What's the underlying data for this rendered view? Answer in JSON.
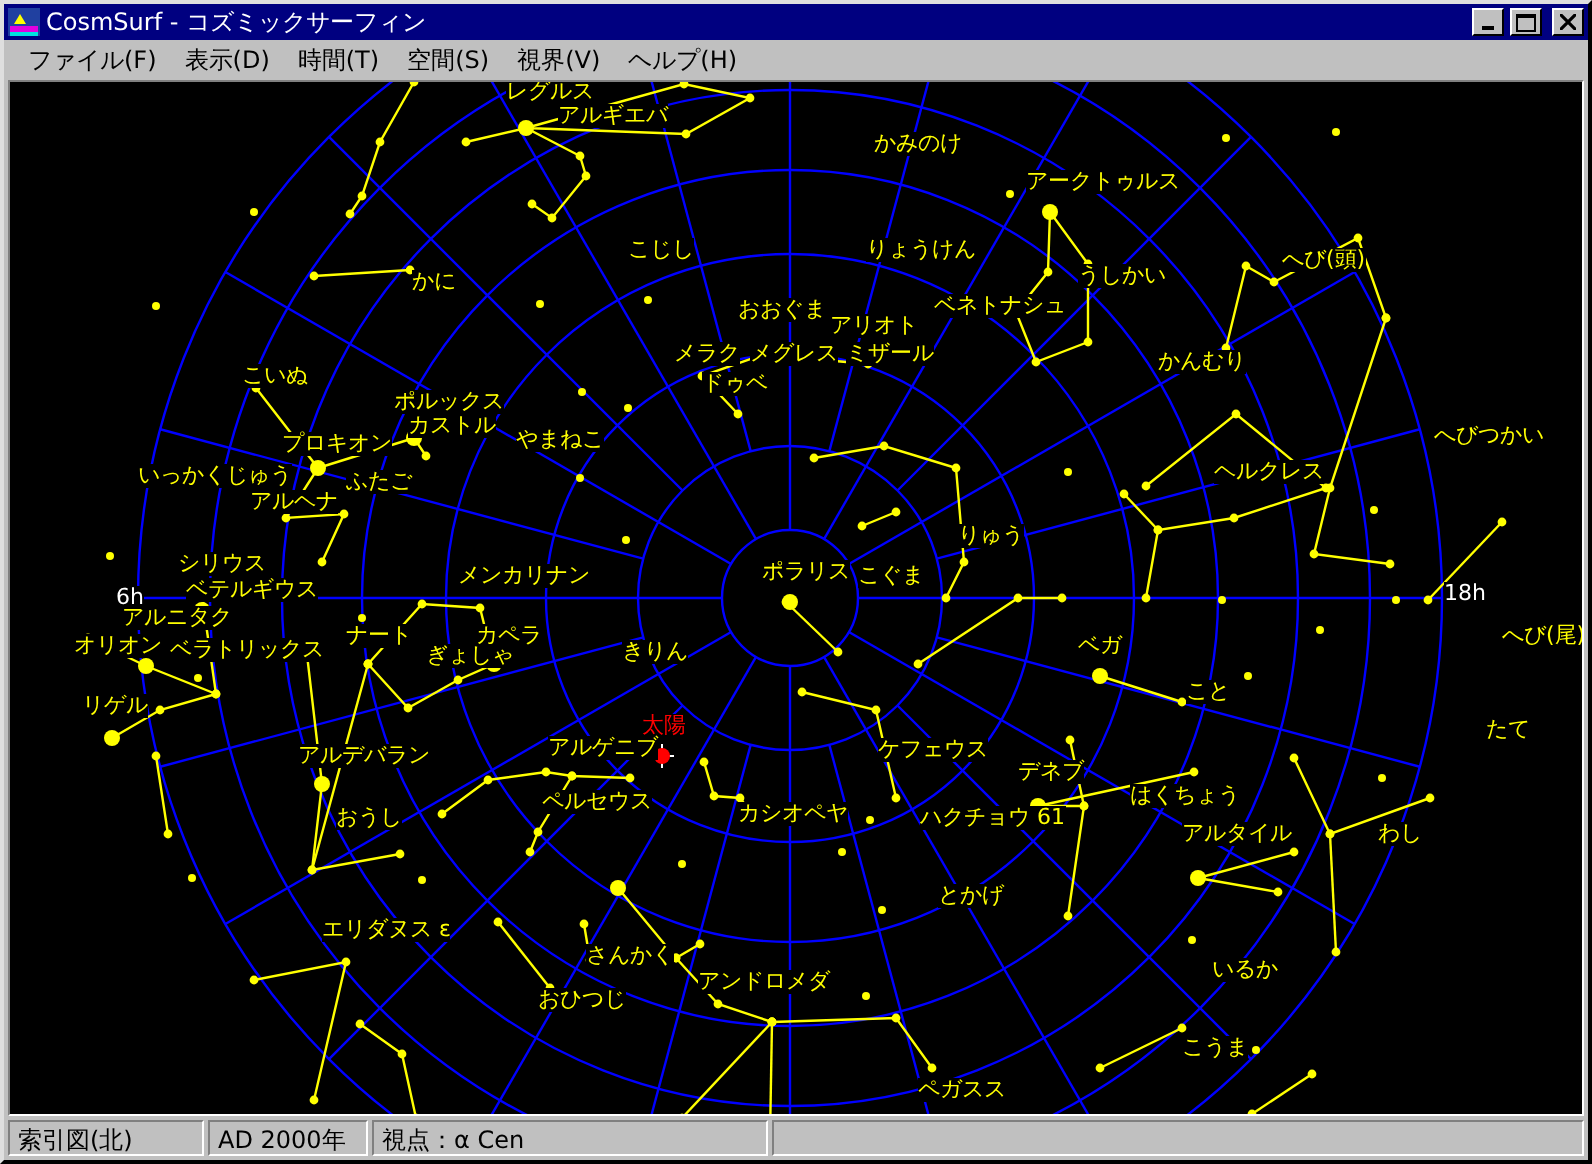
{
  "window": {
    "title": "CosmSurf - コズミックサーフィン"
  },
  "menu": [
    {
      "label": "ファイル(F)"
    },
    {
      "label": "表示(D)"
    },
    {
      "label": "時間(T)"
    },
    {
      "label": "空間(S)"
    },
    {
      "label": "視界(V)"
    },
    {
      "label": "ヘルプ(H)"
    }
  ],
  "sky_chart": {
    "labels": [
      {
        "text": "レグルス",
        "kind": "star"
      },
      {
        "text": "アルギエバ",
        "kind": "star"
      },
      {
        "text": "かみのけ",
        "kind": "constellation"
      },
      {
        "text": "アークトゥルス",
        "kind": "star"
      },
      {
        "text": "こじし",
        "kind": "constellation"
      },
      {
        "text": "りょうけん",
        "kind": "constellation"
      },
      {
        "text": "かに",
        "kind": "constellation"
      },
      {
        "text": "うしかい",
        "kind": "constellation"
      },
      {
        "text": "へび(頭)",
        "kind": "constellation"
      },
      {
        "text": "ベネトナシュ",
        "kind": "star"
      },
      {
        "text": "おおぐま",
        "kind": "constellation"
      },
      {
        "text": "アリオト",
        "kind": "star"
      },
      {
        "text": "メラク",
        "kind": "star"
      },
      {
        "text": "メグレス",
        "kind": "star"
      },
      {
        "text": "ミザール",
        "kind": "star"
      },
      {
        "text": "ドゥベ",
        "kind": "star"
      },
      {
        "text": "かんむり",
        "kind": "constellation"
      },
      {
        "text": "こいぬ",
        "kind": "constellation"
      },
      {
        "text": "ポルックス",
        "kind": "star"
      },
      {
        "text": "カストル",
        "kind": "star"
      },
      {
        "text": "プロキオン",
        "kind": "star"
      },
      {
        "text": "やまねこ",
        "kind": "constellation"
      },
      {
        "text": "へびつかい",
        "kind": "constellation"
      },
      {
        "text": "いっかくじゅう",
        "kind": "constellation"
      },
      {
        "text": "アルヘナ",
        "kind": "star"
      },
      {
        "text": "ふたご",
        "kind": "constellation"
      },
      {
        "text": "ヘルクレス",
        "kind": "constellation"
      },
      {
        "text": "りゅう",
        "kind": "constellation"
      },
      {
        "text": "シリウス",
        "kind": "star"
      },
      {
        "text": "ベテルギウス",
        "kind": "star"
      },
      {
        "text": "メンカリナン",
        "kind": "star"
      },
      {
        "text": "ポラリス",
        "kind": "star"
      },
      {
        "text": "こぐま",
        "kind": "constellation"
      },
      {
        "text": "6h",
        "kind": "hour"
      },
      {
        "text": "18h",
        "kind": "hour"
      },
      {
        "text": "アルニタク",
        "kind": "star"
      },
      {
        "text": "オリオン",
        "kind": "constellation"
      },
      {
        "text": "ベラトリックス",
        "kind": "star"
      },
      {
        "text": "リゲル",
        "kind": "star"
      },
      {
        "text": "ナート",
        "kind": "star"
      },
      {
        "text": "カペラ",
        "kind": "star"
      },
      {
        "text": "ぎょしゃ",
        "kind": "constellation"
      },
      {
        "text": "きりん",
        "kind": "constellation"
      },
      {
        "text": "ベガ",
        "kind": "star"
      },
      {
        "text": "こと",
        "kind": "constellation"
      },
      {
        "text": "へび(尾)",
        "kind": "constellation"
      },
      {
        "text": "たて",
        "kind": "constellation"
      },
      {
        "text": "太陽",
        "kind": "sun"
      },
      {
        "text": "アルゲニブ",
        "kind": "star"
      },
      {
        "text": "アルデバラン",
        "kind": "star"
      },
      {
        "text": "ケフェウス",
        "kind": "constellation"
      },
      {
        "text": "デネブ",
        "kind": "star"
      },
      {
        "text": "おうし",
        "kind": "constellation"
      },
      {
        "text": "ペルセウス",
        "kind": "constellation"
      },
      {
        "text": "はくちょう",
        "kind": "constellation"
      },
      {
        "text": "カシオペヤ",
        "kind": "constellation"
      },
      {
        "text": "ハクチョウ 61",
        "kind": "star"
      },
      {
        "text": "アルタイル",
        "kind": "star"
      },
      {
        "text": "わし",
        "kind": "constellation"
      },
      {
        "text": "とかげ",
        "kind": "constellation"
      },
      {
        "text": "エリダヌス ε",
        "kind": "star"
      },
      {
        "text": "さんかく",
        "kind": "constellation"
      },
      {
        "text": "いるか",
        "kind": "constellation"
      },
      {
        "text": "アンドロメダ",
        "kind": "constellation"
      },
      {
        "text": "おひつじ",
        "kind": "constellation"
      },
      {
        "text": "こうま",
        "kind": "constellation"
      },
      {
        "text": "ペガスス",
        "kind": "constellation"
      }
    ]
  },
  "status_bar": [
    "索引図(北)",
    "AD 2000年",
    "視点：α Cen"
  ]
}
